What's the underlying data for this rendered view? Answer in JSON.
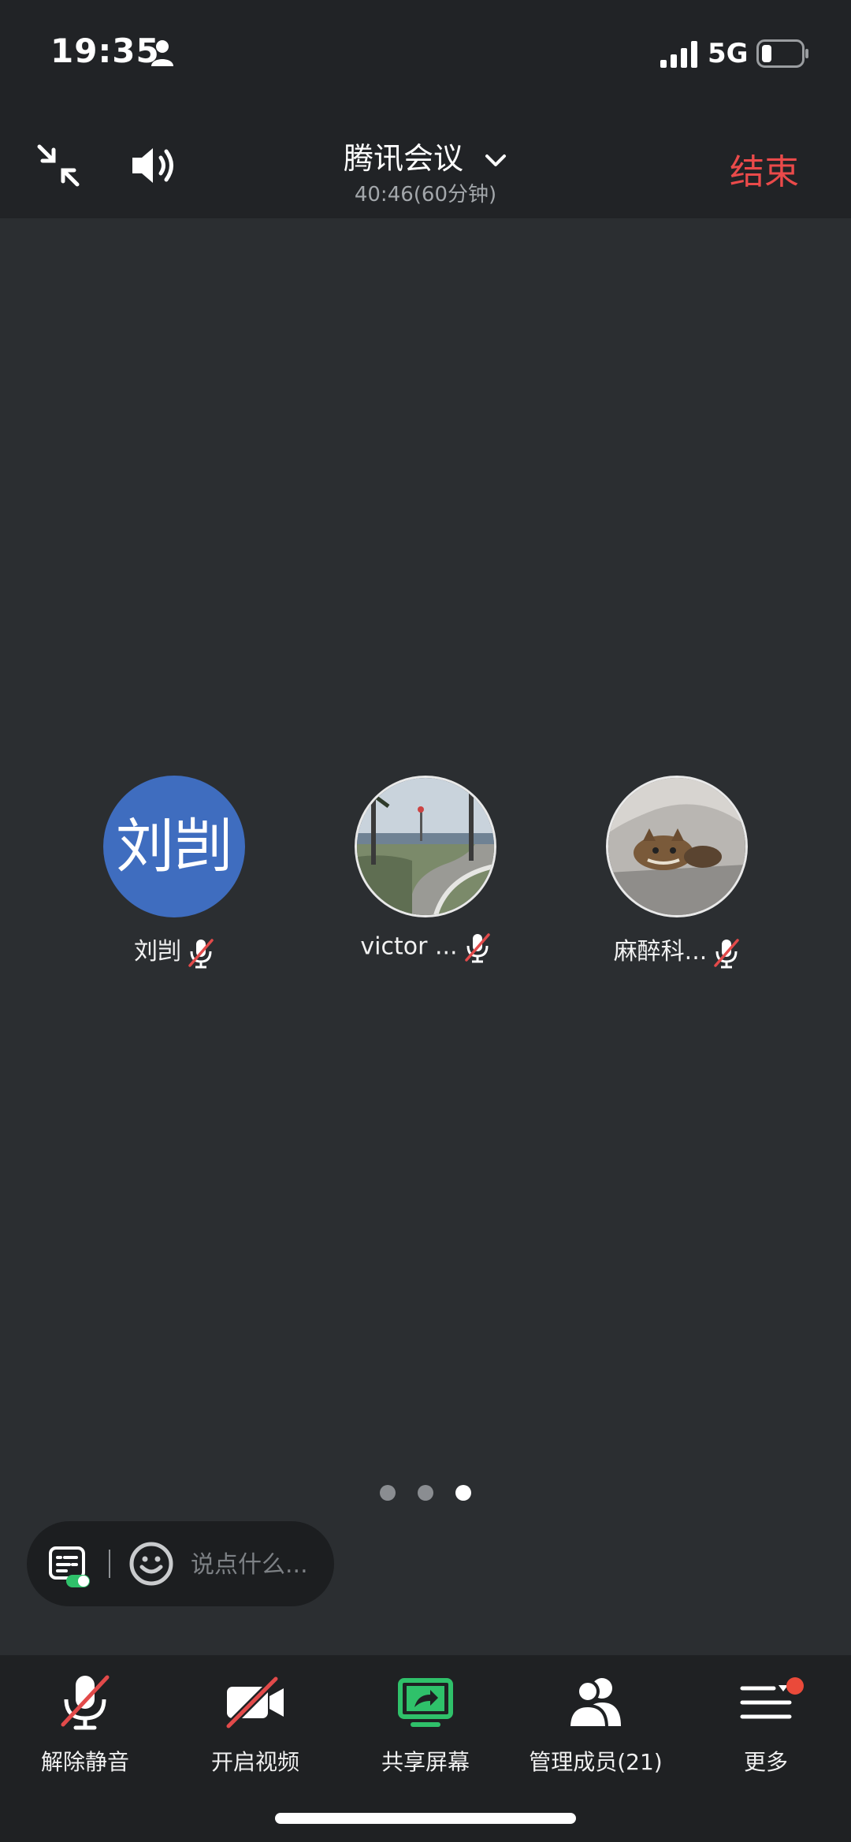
{
  "status_bar": {
    "time": "19:35",
    "network": "5G"
  },
  "header": {
    "title": "腾讯会议",
    "duration": "40:46(60分钟)",
    "end_label": "结束"
  },
  "participants": [
    {
      "name": "刘剀",
      "avatar_text": "刘剀",
      "muted": true
    },
    {
      "name": "victor ...",
      "avatar": "photo-seaside",
      "muted": true
    },
    {
      "name": "麻醉科...",
      "avatar": "photo-cat",
      "muted": true
    }
  ],
  "pager": {
    "pages": 3,
    "active_index": 2
  },
  "chat": {
    "placeholder": "说点什么..."
  },
  "bottom_bar": {
    "tabs": [
      {
        "label": "解除静音",
        "icon": "mic-muted-icon"
      },
      {
        "label": "开启视频",
        "icon": "video-off-icon"
      },
      {
        "label": "共享屏幕",
        "icon": "share-screen-icon"
      },
      {
        "label": "管理成员(21)",
        "icon": "members-icon"
      },
      {
        "label": "更多",
        "icon": "more-menu-icon"
      }
    ]
  },
  "colors": {
    "end_red": "#ea4a4a",
    "share_green": "#2fc16a",
    "avatar_blue": "#3f6dbf",
    "badge_red": "#ea4a3a"
  }
}
